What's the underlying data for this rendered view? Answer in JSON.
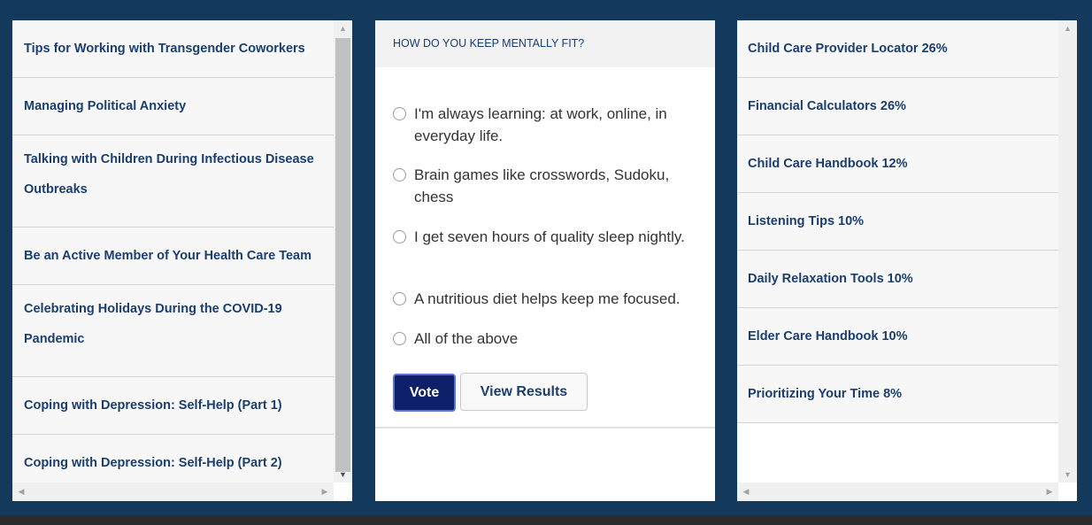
{
  "left_list": {
    "items": [
      "Tips for Working with Transgender Coworkers",
      "Managing Political Anxiety",
      "Talking with Children During Infectious Disease Outbreaks",
      "Be an Active Member of Your Health Care Team",
      "Celebrating Holidays During the COVID-19 Pandemic",
      "Coping with Depression: Self-Help (Part 1)",
      "Coping with Depression: Self-Help (Part 2)"
    ]
  },
  "poll": {
    "question": "HOW DO YOU KEEP MENTALLY FIT?",
    "options": [
      "I'm always learning: at work, online, in everyday life.",
      "Brain games like crosswords, Sudoku, chess",
      "I get seven hours of quality sleep nightly.",
      "A nutritious diet helps keep me focused.",
      "All of the above"
    ],
    "vote_label": "Vote",
    "results_label": "View Results"
  },
  "right_list": {
    "items": [
      "Child Care Provider Locator 26%",
      "Financial Calculators 26%",
      "Child Care Handbook 12%",
      "Listening Tips 10%",
      "Daily Relaxation Tools 10%",
      "Elder Care Handbook 10%",
      "Prioritizing Your Time 8%"
    ]
  },
  "colors": {
    "background": "#133a5c",
    "link_text": "#1a3e6e",
    "vote_button": "#0e1f6a"
  },
  "icons": {
    "scroll_up": "triangle-up",
    "scroll_down": "triangle-down",
    "scroll_left": "triangle-left",
    "scroll_right": "triangle-right"
  }
}
